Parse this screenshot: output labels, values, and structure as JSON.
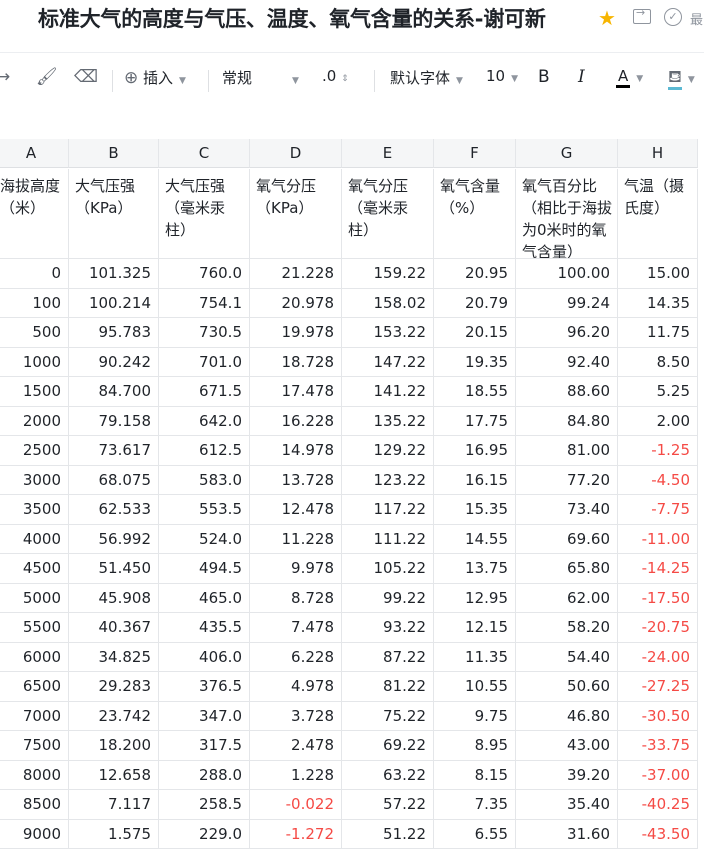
{
  "titlebar": {
    "title": "标准大气的高度与气压、温度、氧气含量的关系-谢可新",
    "more_label": "最",
    "icons": [
      "star-icon",
      "move-icon",
      "check-circle-icon"
    ]
  },
  "toolbar": {
    "insert_label": "插入",
    "format_label": "常规",
    "decimal_label": ".0",
    "font_label": "默认字体",
    "size_label": "10",
    "bold_label": "B",
    "italic_label": "I",
    "color_label": "A",
    "text_color": "#000000",
    "fill_color": "#5bb9d3"
  },
  "columns": [
    "A",
    "B",
    "C",
    "D",
    "E",
    "F",
    "G",
    "H"
  ],
  "headers": [
    "海拔高度（米）",
    "大气压强（KPa）",
    "大气压强（毫米汞柱）",
    "氧气分压（KPa）",
    "氧气分压（毫米汞柱）",
    "氧气含量（%）",
    "氧气百分比（相比于海拔为0米时的氧气含量）",
    "气温（摄氏度）"
  ],
  "rows": [
    [
      "0",
      "101.325",
      "760.0",
      "21.228",
      "159.22",
      "20.95",
      "100.00",
      "15.00"
    ],
    [
      "100",
      "100.214",
      "754.1",
      "20.978",
      "158.02",
      "20.79",
      "99.24",
      "14.35"
    ],
    [
      "500",
      "95.783",
      "730.5",
      "19.978",
      "153.22",
      "20.15",
      "96.20",
      "11.75"
    ],
    [
      "1000",
      "90.242",
      "701.0",
      "18.728",
      "147.22",
      "19.35",
      "92.40",
      "8.50"
    ],
    [
      "1500",
      "84.700",
      "671.5",
      "17.478",
      "141.22",
      "18.55",
      "88.60",
      "5.25"
    ],
    [
      "2000",
      "79.158",
      "642.0",
      "16.228",
      "135.22",
      "17.75",
      "84.80",
      "2.00"
    ],
    [
      "2500",
      "73.617",
      "612.5",
      "14.978",
      "129.22",
      "16.95",
      "81.00",
      "-1.25"
    ],
    [
      "3000",
      "68.075",
      "583.0",
      "13.728",
      "123.22",
      "16.15",
      "77.20",
      "-4.50"
    ],
    [
      "3500",
      "62.533",
      "553.5",
      "12.478",
      "117.22",
      "15.35",
      "73.40",
      "-7.75"
    ],
    [
      "4000",
      "56.992",
      "524.0",
      "11.228",
      "111.22",
      "14.55",
      "69.60",
      "-11.00"
    ],
    [
      "4500",
      "51.450",
      "494.5",
      "9.978",
      "105.22",
      "13.75",
      "65.80",
      "-14.25"
    ],
    [
      "5000",
      "45.908",
      "465.0",
      "8.728",
      "99.22",
      "12.95",
      "62.00",
      "-17.50"
    ],
    [
      "5500",
      "40.367",
      "435.5",
      "7.478",
      "93.22",
      "12.15",
      "58.20",
      "-20.75"
    ],
    [
      "6000",
      "34.825",
      "406.0",
      "6.228",
      "87.22",
      "11.35",
      "54.40",
      "-24.00"
    ],
    [
      "6500",
      "29.283",
      "376.5",
      "4.978",
      "81.22",
      "10.55",
      "50.60",
      "-27.25"
    ],
    [
      "7000",
      "23.742",
      "347.0",
      "3.728",
      "75.22",
      "9.75",
      "46.80",
      "-30.50"
    ],
    [
      "7500",
      "18.200",
      "317.5",
      "2.478",
      "69.22",
      "8.95",
      "43.00",
      "-33.75"
    ],
    [
      "8000",
      "12.658",
      "288.0",
      "1.228",
      "63.22",
      "8.15",
      "39.20",
      "-37.00"
    ],
    [
      "8500",
      "7.117",
      "258.5",
      "-0.022",
      "57.22",
      "7.35",
      "35.40",
      "-40.25"
    ],
    [
      "9000",
      "1.575",
      "229.0",
      "-1.272",
      "51.22",
      "6.55",
      "31.60",
      "-43.50"
    ]
  ],
  "negative_color": "#f54a45"
}
